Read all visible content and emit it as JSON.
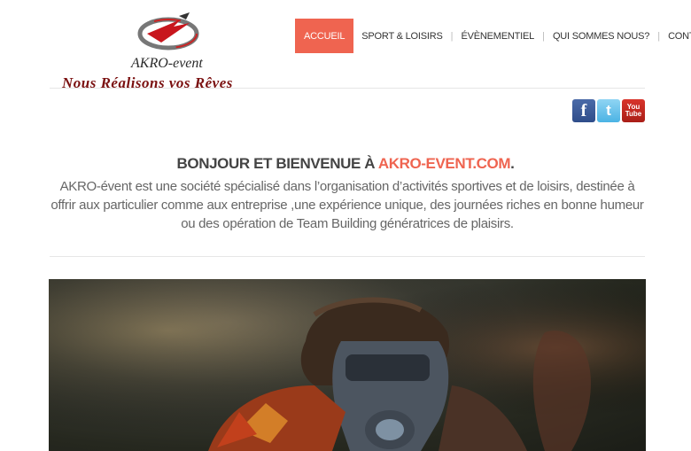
{
  "header": {
    "brand": "AKRO-event",
    "tagline": "Nous Réalisons vos Rêves"
  },
  "nav": {
    "items": [
      {
        "label": "Accueil",
        "active": true
      },
      {
        "label": "Sport & Loisirs"
      },
      {
        "label": "Évènementiel"
      },
      {
        "label": "Qui sommes nous?"
      },
      {
        "label": "Contact"
      }
    ]
  },
  "social": {
    "icons": [
      "facebook-icon",
      "twitter-icon",
      "youtube-icon"
    ],
    "youtube_text_1": "You",
    "youtube_text_2": "Tube"
  },
  "welcome": {
    "title_prefix": "BONJOUR ET BIENVENUE À ",
    "title_accent": "AKRO-EVENT.COM",
    "title_suffix": ".",
    "text": "AKRO-évent est une société spécialisé dans l’organisation d’activités sportives et de loisirs, destinée à offrir aux particulier comme aux entreprise ,une expérience unique, des journées riches en bonne humeur ou des opération de Team Building génératrices de plaisirs."
  },
  "colors": {
    "accent": "#ef6450",
    "tagline": "#7a1010"
  }
}
